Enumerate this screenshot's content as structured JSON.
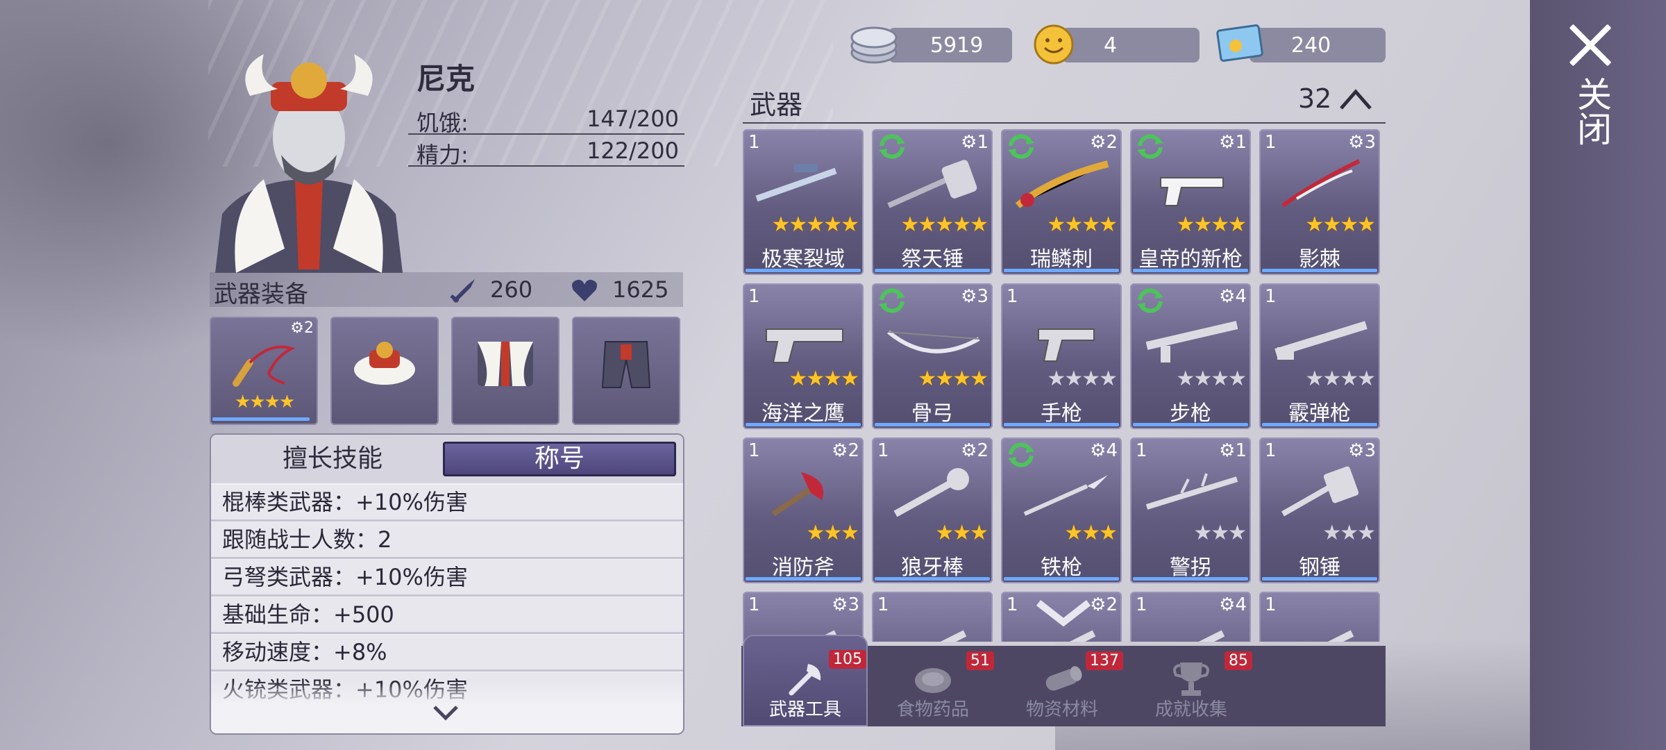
{
  "close": {
    "label": "关闭"
  },
  "currency": {
    "silver": "5919",
    "gold": "4",
    "ticket": "240"
  },
  "character": {
    "name": "尼克",
    "hunger_label": "饥饿:",
    "hunger_value": "147/200",
    "energy_label": "精力:",
    "energy_value": "122/200"
  },
  "equipment": {
    "title": "武器装备",
    "attack": "260",
    "health": "1625",
    "slots": [
      {
        "name": "whip",
        "gear": "2",
        "stars": "★★★★"
      },
      {
        "name": "hat"
      },
      {
        "name": "coat"
      },
      {
        "name": "pants"
      }
    ]
  },
  "skills": {
    "tab_skills": "擅长技能",
    "tab_title": "称号",
    "lines": [
      "棍棒类武器：+10%伤害",
      "跟随战士人数：2",
      "弓弩类武器：+10%伤害",
      "基础生命：+500",
      "移动速度：+8%",
      "火铳类武器：+10%伤害"
    ]
  },
  "weapons": {
    "title": "武器",
    "count": "32",
    "items": [
      {
        "name": "极寒裂域",
        "lvl": "1",
        "gear": "",
        "stars": "★★★★★",
        "gold": true,
        "refresh": false
      },
      {
        "name": "祭天锤",
        "lvl": "",
        "gear": "1",
        "stars": "★★★★★",
        "gold": true,
        "refresh": true
      },
      {
        "name": "瑞鳞刺",
        "lvl": "",
        "gear": "2",
        "stars": "★★★★",
        "gold": true,
        "refresh": true
      },
      {
        "name": "皇帝的新枪",
        "lvl": "",
        "gear": "1",
        "stars": "★★★★",
        "gold": true,
        "refresh": true
      },
      {
        "name": "影棘",
        "lvl": "1",
        "gear": "3",
        "stars": "★★★★",
        "gold": true,
        "refresh": false
      },
      {
        "name": "海洋之鹰",
        "lvl": "1",
        "gear": "",
        "stars": "★★★★",
        "gold": true,
        "refresh": false
      },
      {
        "name": "骨弓",
        "lvl": "",
        "gear": "3",
        "stars": "★★★★",
        "gold": true,
        "refresh": true
      },
      {
        "name": "手枪",
        "lvl": "1",
        "gear": "",
        "stars": "★★★★",
        "gold": false,
        "refresh": false
      },
      {
        "name": "步枪",
        "lvl": "",
        "gear": "4",
        "stars": "★★★★",
        "gold": false,
        "refresh": true
      },
      {
        "name": "霰弹枪",
        "lvl": "1",
        "gear": "",
        "stars": "★★★★",
        "gold": false,
        "refresh": false
      },
      {
        "name": "消防斧",
        "lvl": "1",
        "gear": "2",
        "stars": "★★★",
        "gold": true,
        "refresh": false
      },
      {
        "name": "狼牙棒",
        "lvl": "1",
        "gear": "2",
        "stars": "★★★",
        "gold": true,
        "refresh": false
      },
      {
        "name": "铁枪",
        "lvl": "",
        "gear": "4",
        "stars": "★★★",
        "gold": true,
        "refresh": true
      },
      {
        "name": "警拐",
        "lvl": "1",
        "gear": "1",
        "stars": "★★★",
        "gold": false,
        "refresh": false
      },
      {
        "name": "钢锤",
        "lvl": "1",
        "gear": "3",
        "stars": "★★★",
        "gold": false,
        "refresh": false
      },
      {
        "name": "",
        "lvl": "1",
        "gear": "3",
        "stars": "",
        "gold": false,
        "refresh": false
      },
      {
        "name": "",
        "lvl": "1",
        "gear": "",
        "stars": "",
        "gold": false,
        "refresh": false
      },
      {
        "name": "",
        "lvl": "1",
        "gear": "2",
        "stars": "",
        "gold": false,
        "refresh": false
      },
      {
        "name": "",
        "lvl": "1",
        "gear": "4",
        "stars": "",
        "gold": false,
        "refresh": false
      },
      {
        "name": "",
        "lvl": "1",
        "gear": "",
        "stars": "",
        "gold": false,
        "refresh": false
      }
    ]
  },
  "bottom_tabs": [
    {
      "label": "武器工具",
      "badge": "105",
      "icon": "axe-tools-icon"
    },
    {
      "label": "食物药品",
      "badge": "51",
      "icon": "meat-icon"
    },
    {
      "label": "物资材料",
      "badge": "137",
      "icon": "log-icon"
    },
    {
      "label": "成就收集",
      "badge": "85",
      "icon": "trophy-icon"
    }
  ]
}
